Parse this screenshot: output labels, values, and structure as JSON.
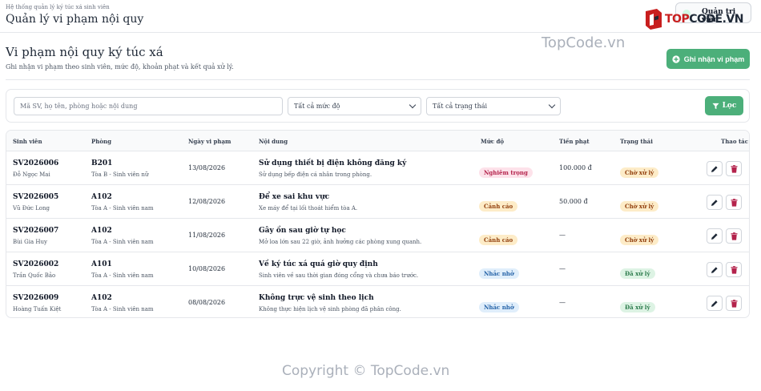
{
  "header": {
    "system_name": "Hệ thống quản lý ký túc xá sinh viên",
    "app_title": "Quản lý vi phạm nội quy",
    "user_label": "Quản trị viên",
    "logo_text_red": "TOP",
    "logo_text_dark": "CODE.VN"
  },
  "watermark": "TopCode.vn",
  "page": {
    "title": "Vi phạm nội quy ký túc xá",
    "subtitle": "Ghi nhận vi phạm theo sinh viên, mức độ, khoản phạt và kết quả xử lý.",
    "primary_action": "Ghi nhận vi phạm"
  },
  "filters": {
    "search_placeholder": "Mã SV, họ tên, phòng hoặc nội dung",
    "level_select": "Tất cả mức độ",
    "status_select": "Tất cả trạng thái",
    "filter_button": "Lọc"
  },
  "table": {
    "columns": [
      "Sinh viên",
      "Phòng",
      "Ngày vi phạm",
      "Nội dung",
      "Mức độ",
      "Tiền phạt",
      "Trạng thái",
      "Thao tác"
    ],
    "rows": [
      {
        "code": "SV2026006",
        "name": "Đỗ Ngọc Mai",
        "room": "B201",
        "building": "Tòa B - Sinh viên nữ",
        "date": "13/08/2026",
        "title": "Sử dụng thiết bị điện không đăng ký",
        "desc": "Sử dụng bếp điện cá nhân trong phòng.",
        "level": "Nghiêm trọng",
        "fine": "100.000 đ",
        "status": "Chờ xử lý"
      },
      {
        "code": "SV2026005",
        "name": "Vũ Đức Long",
        "room": "A102",
        "building": "Tòa A - Sinh viên nam",
        "date": "12/08/2026",
        "title": "Để xe sai khu vực",
        "desc": "Xe máy để tại lối thoát hiểm tòa A.",
        "level": "Cảnh cáo",
        "fine": "50.000 đ",
        "status": "Chờ xử lý"
      },
      {
        "code": "SV2026007",
        "name": "Bùi Gia Huy",
        "room": "A102",
        "building": "Tòa A - Sinh viên nam",
        "date": "11/08/2026",
        "title": "Gây ồn sau giờ tự học",
        "desc": "Mở loa lớn sau 22 giờ, ảnh hưởng các phòng xung quanh.",
        "level": "Cảnh cáo",
        "fine": "—",
        "status": "Chờ xử lý"
      },
      {
        "code": "SV2026002",
        "name": "Trần Quốc Bảo",
        "room": "A101",
        "building": "Tòa A - Sinh viên nam",
        "date": "10/08/2026",
        "title": "Về ký túc xá quá giờ quy định",
        "desc": "Sinh viên về sau thời gian đóng cổng và chưa báo trước.",
        "level": "Nhắc nhở",
        "fine": "—",
        "status": "Đã xử lý"
      },
      {
        "code": "SV2026009",
        "name": "Hoàng Tuấn Kiệt",
        "room": "A102",
        "building": "Tòa A - Sinh viên nam",
        "date": "08/08/2026",
        "title": "Không trực vệ sinh theo lịch",
        "desc": "Không thực hiện lịch vệ sinh phòng đã phân công.",
        "level": "Nhắc nhở",
        "fine": "—",
        "status": "Đã xử lý"
      }
    ]
  },
  "badge_colors": {
    "Nghiêm trọng": {
      "bg": "#fde2ea",
      "fg": "#b4234c"
    },
    "Cảnh cáo": {
      "bg": "#fdecc8",
      "fg": "#92400e"
    },
    "Nhắc nhở": {
      "bg": "#e0eefb",
      "fg": "#2563a8"
    },
    "Chờ xử lý": {
      "bg": "#fdecc8",
      "fg": "#92400e"
    },
    "Đã xử lý": {
      "bg": "#ddf3e4",
      "fg": "#2f7d4f"
    }
  },
  "icons": {
    "add": "plus-circle-icon",
    "filter": "funnel-icon",
    "edit": "pencil-icon",
    "delete": "trash-icon"
  },
  "copyright": "Copyright © TopCode.vn"
}
